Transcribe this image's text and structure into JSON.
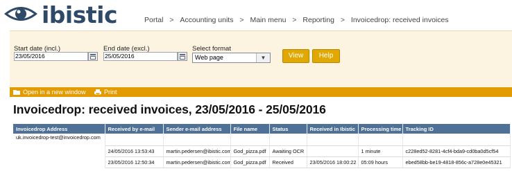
{
  "brand": {
    "logo_text": "ibistic"
  },
  "breadcrumb": [
    "Portal",
    "Accounting units",
    "Main menu",
    "Reporting",
    "Invoicedrop: received invoices"
  ],
  "breadcrumb_separator": ">",
  "form": {
    "start_label": "Start date (incl.)",
    "start_value": "23/05/2016",
    "end_label": "End date (excl.)",
    "end_value": "25/05/2016",
    "format_label": "Select format",
    "format_value": "Web page",
    "view_label": "View",
    "help_label": "Help"
  },
  "toolbar": {
    "open_label": "Open in a new window",
    "print_label": "Print"
  },
  "report_title": "Invoicedrop: received invoices, 23/05/2016 - 25/05/2016",
  "table": {
    "headers": [
      "Invoicedrop Address",
      "Received by e-mail",
      "Sender e-mail address",
      "File name",
      "Status",
      "Received in Ibistic",
      "Processing time",
      "Tracking ID"
    ],
    "group_address": "uk.invoicedrop-test@invoicedrop.com",
    "rows": [
      [
        "",
        "24/05/2016 13:53:43",
        "martin.pedersen@ibistic.com",
        "God_pizza.pdf",
        "Awaiting OCR",
        "",
        "1 minute",
        "c228ed52-8281-4cf4-bda9-cd0ba0d5cf54"
      ],
      [
        "",
        "23/05/2016 12:50:34",
        "martin.pedersen@ibistic.com",
        "God_pizza.pdf",
        "Received",
        "23/05/2016 18:00:22",
        "05:09 hours",
        "ebed58bb-be19-4818-856c-a728e0e45321"
      ]
    ]
  },
  "colors": {
    "toolbar_orange": "#e29b00",
    "button_gold": "#e0a800",
    "table_header_blue": "#4f7197",
    "panel_cream": "#fdf3e1",
    "logo_navy": "#2f4a66"
  }
}
